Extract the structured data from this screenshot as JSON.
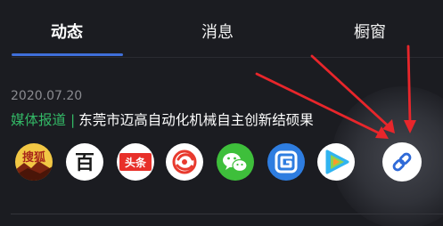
{
  "tabs": [
    {
      "label": "动态",
      "active": true
    },
    {
      "label": "消息",
      "active": false
    },
    {
      "label": "橱窗",
      "active": false
    }
  ],
  "news": {
    "date": "2020.07.20",
    "source": "媒体报道",
    "separator": "|",
    "title": "东莞市迈高自动化机械自主创新结硕果"
  },
  "share_targets": [
    {
      "name": "sohu",
      "icon": "sohu-icon",
      "glyph": "搜狐"
    },
    {
      "name": "baidu",
      "icon": "baidu-icon",
      "glyph": "百"
    },
    {
      "name": "toutiao",
      "icon": "toutiao-icon",
      "glyph": "头条"
    },
    {
      "name": "ifeng",
      "icon": "phoenix-icon",
      "glyph": ""
    },
    {
      "name": "wechat",
      "icon": "wechat-icon",
      "glyph": ""
    },
    {
      "name": "sina",
      "icon": "sina-icon",
      "glyph": ""
    },
    {
      "name": "tencent-video",
      "icon": "tencent-video-icon",
      "glyph": ""
    },
    {
      "name": "copy-link",
      "icon": "link-icon",
      "glyph": ""
    }
  ],
  "colors": {
    "background": "#1b1c21",
    "accent": "#3f6fd9",
    "source": "#33b866",
    "annotation_arrow": "#e8262b"
  }
}
